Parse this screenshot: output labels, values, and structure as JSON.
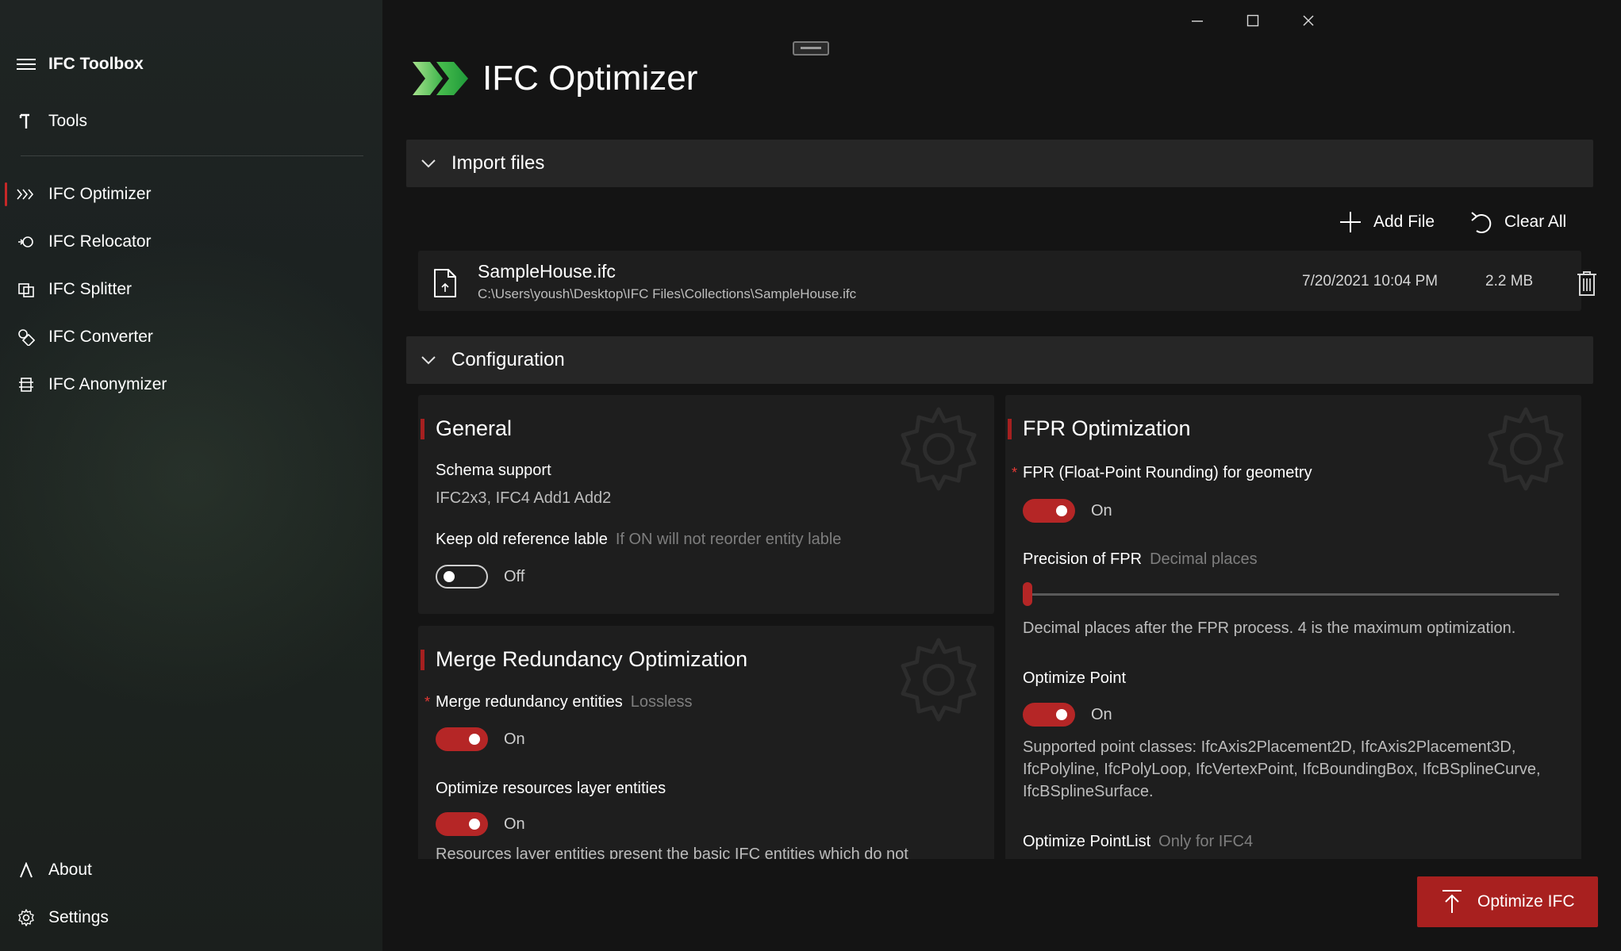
{
  "window": {
    "minimize_icon": "minimize-icon",
    "maximize_icon": "maximize-icon",
    "close_icon": "close-icon"
  },
  "sidebar": {
    "app_title": "IFC Toolbox",
    "tools_label": "Tools",
    "items": [
      {
        "label": "IFC Optimizer",
        "icon": "optimizer-icon",
        "active": true
      },
      {
        "label": "IFC Relocator",
        "icon": "relocator-icon",
        "active": false
      },
      {
        "label": "IFC Splitter",
        "icon": "splitter-icon",
        "active": false
      },
      {
        "label": "IFC Converter",
        "icon": "converter-icon",
        "active": false
      },
      {
        "label": "IFC Anonymizer",
        "icon": "anonymizer-icon",
        "active": false
      }
    ],
    "about_label": "About",
    "settings_label": "Settings",
    "accent_color": "#c62828"
  },
  "header": {
    "title": "IFC Optimizer"
  },
  "import_section": {
    "title": "Import files",
    "add_file_label": "Add File",
    "clear_all_label": "Clear All",
    "files": [
      {
        "name": "SampleHouse.ifc",
        "path": "C:\\Users\\yoush\\Desktop\\IFC Files\\Collections\\SampleHouse.ifc",
        "date": "7/20/2021 10:04 PM",
        "size": "2.2 MB"
      }
    ]
  },
  "config_section": {
    "title": "Configuration",
    "general": {
      "title": "General",
      "schema_label": "Schema support",
      "schema_value": "IFC2x3, IFC4 Add1 Add2",
      "keep_label": "Keep old reference lable",
      "keep_hint": "If ON will not reorder entity lable",
      "keep_state": "Off"
    },
    "merge": {
      "title": "Merge Redundancy Optimization",
      "merge_label": "Merge redundancy entities",
      "merge_hint": "Lossless",
      "merge_state": "On",
      "resources_label": "Optimize resources layer entities",
      "resources_state": "On",
      "resources_desc": "Resources layer entities present the basic IFC entities which do not"
    },
    "fpr": {
      "title": "FPR Optimization",
      "fpr_label": "FPR (Float-Point Rounding) for geometry",
      "fpr_state": "On",
      "precision_label": "Precision of FPR",
      "precision_hint": "Decimal places",
      "precision_desc": "Decimal places after the FPR process. 4 is the maximum optimization.",
      "point_label": "Optimize Point",
      "point_state": "On",
      "point_desc_1": "Supported point classes: IfcAxis2Placement2D, IfcAxis2Placement3D,",
      "point_desc_2": "IfcPolyline, IfcPolyLoop, IfcVertexPoint, IfcBoundingBox, IfcBSplineCurve,",
      "point_desc_3": "IfcBSplineSurface.",
      "pointlist_label": "Optimize PointList",
      "pointlist_hint": "Only for IFC4"
    }
  },
  "action": {
    "optimize_label": "Optimize IFC"
  }
}
